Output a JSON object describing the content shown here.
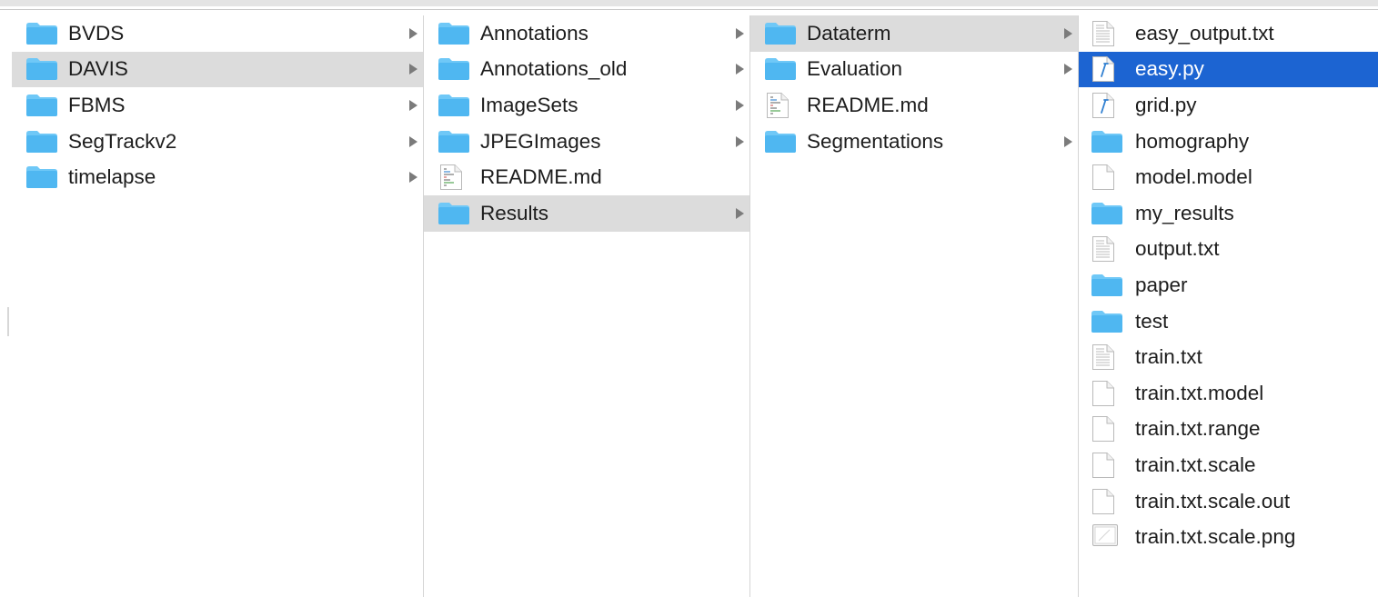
{
  "columns": [
    {
      "items": [
        {
          "label": "BVDS",
          "icon": "folder-icon",
          "arrow": true,
          "state": ""
        },
        {
          "label": "DAVIS",
          "icon": "folder-icon",
          "arrow": true,
          "state": "path"
        },
        {
          "label": "FBMS",
          "icon": "folder-icon",
          "arrow": true,
          "state": ""
        },
        {
          "label": "SegTrackv2",
          "icon": "folder-icon",
          "arrow": true,
          "state": ""
        },
        {
          "label": "timelapse",
          "icon": "folder-icon",
          "arrow": true,
          "state": ""
        }
      ]
    },
    {
      "items": [
        {
          "label": "Annotations",
          "icon": "folder-icon",
          "arrow": true,
          "state": ""
        },
        {
          "label": "Annotations_old",
          "icon": "folder-icon",
          "arrow": true,
          "state": ""
        },
        {
          "label": "ImageSets",
          "icon": "folder-icon",
          "arrow": true,
          "state": ""
        },
        {
          "label": "JPEGImages",
          "icon": "folder-icon",
          "arrow": true,
          "state": ""
        },
        {
          "label": "README.md",
          "icon": "markdown-file-icon",
          "arrow": false,
          "state": ""
        },
        {
          "label": "Results",
          "icon": "folder-icon",
          "arrow": true,
          "state": "path"
        }
      ]
    },
    {
      "items": [
        {
          "label": "Dataterm",
          "icon": "folder-icon",
          "arrow": true,
          "state": "path"
        },
        {
          "label": "Evaluation",
          "icon": "folder-icon",
          "arrow": true,
          "state": ""
        },
        {
          "label": "README.md",
          "icon": "markdown-file-icon",
          "arrow": false,
          "state": ""
        },
        {
          "label": "Segmentations",
          "icon": "folder-icon",
          "arrow": true,
          "state": ""
        }
      ]
    },
    {
      "items": [
        {
          "label": "easy_output.txt",
          "icon": "text-file-icon",
          "arrow": false,
          "state": ""
        },
        {
          "label": "easy.py",
          "icon": "python-file-icon",
          "arrow": false,
          "state": "selected"
        },
        {
          "label": "grid.py",
          "icon": "python-file-icon",
          "arrow": false,
          "state": ""
        },
        {
          "label": "homography",
          "icon": "folder-icon",
          "arrow": false,
          "state": ""
        },
        {
          "label": "model.model",
          "icon": "blank-file-icon",
          "arrow": false,
          "state": ""
        },
        {
          "label": "my_results",
          "icon": "folder-icon",
          "arrow": false,
          "state": ""
        },
        {
          "label": "output.txt",
          "icon": "text-file-icon",
          "arrow": false,
          "state": ""
        },
        {
          "label": "paper",
          "icon": "folder-icon",
          "arrow": false,
          "state": ""
        },
        {
          "label": "test",
          "icon": "folder-icon",
          "arrow": false,
          "state": ""
        },
        {
          "label": "train.txt",
          "icon": "text-file-icon",
          "arrow": false,
          "state": ""
        },
        {
          "label": "train.txt.model",
          "icon": "blank-file-icon",
          "arrow": false,
          "state": ""
        },
        {
          "label": "train.txt.range",
          "icon": "blank-file-icon",
          "arrow": false,
          "state": ""
        },
        {
          "label": "train.txt.scale",
          "icon": "blank-file-icon",
          "arrow": false,
          "state": ""
        },
        {
          "label": "train.txt.scale.out",
          "icon": "blank-file-icon",
          "arrow": false,
          "state": ""
        },
        {
          "label": "train.txt.scale.png",
          "icon": "image-file-icon",
          "arrow": false,
          "state": ""
        }
      ]
    }
  ],
  "colors": {
    "folder": "#4fb7f1",
    "folder_tab": "#6fc8f7",
    "path_highlight": "#dcdcdc",
    "selection": "#1c64d2",
    "python_accent": "#2f7fd1"
  }
}
